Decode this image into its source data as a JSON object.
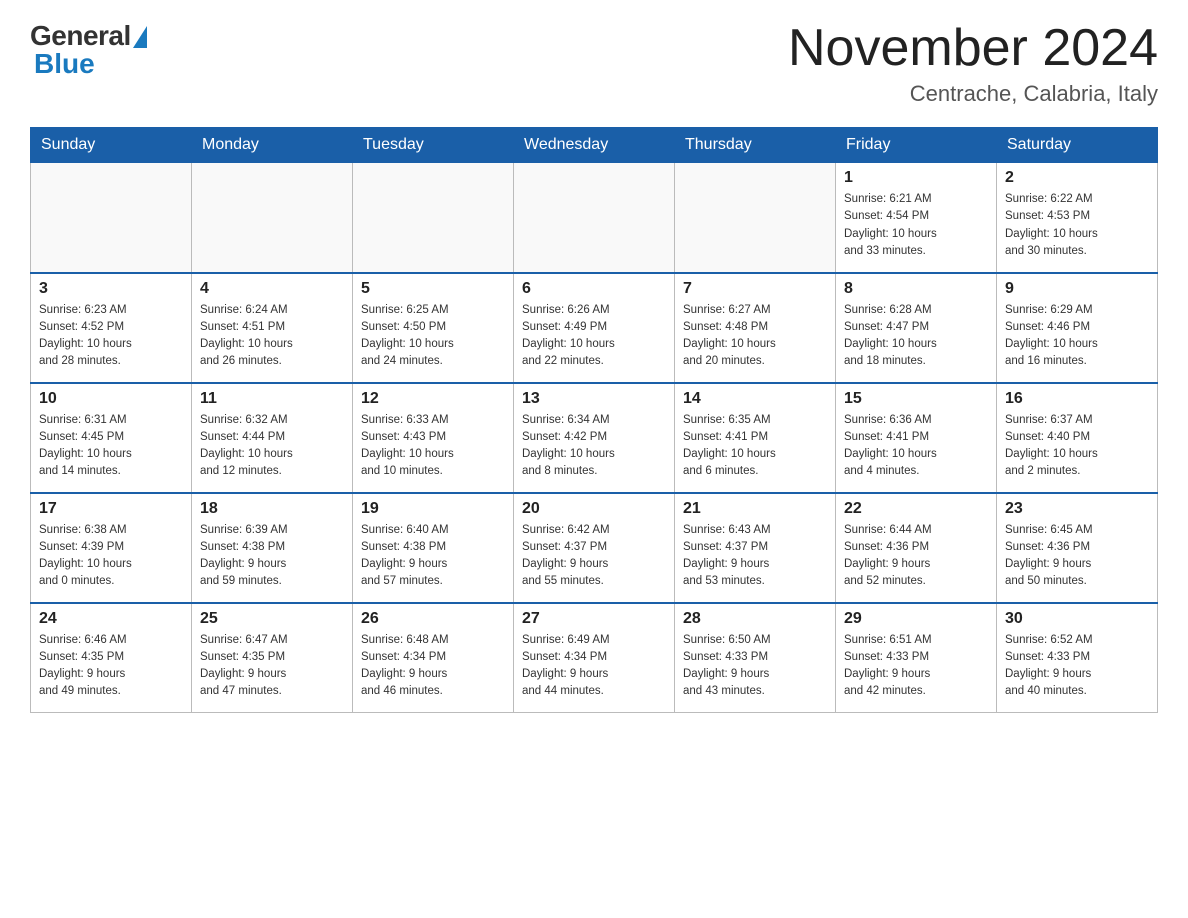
{
  "header": {
    "logo": {
      "general_text": "General",
      "blue_text": "Blue"
    },
    "title": "November 2024",
    "location": "Centrache, Calabria, Italy"
  },
  "days_of_week": [
    "Sunday",
    "Monday",
    "Tuesday",
    "Wednesday",
    "Thursday",
    "Friday",
    "Saturday"
  ],
  "weeks": [
    {
      "days": [
        {
          "number": "",
          "info": ""
        },
        {
          "number": "",
          "info": ""
        },
        {
          "number": "",
          "info": ""
        },
        {
          "number": "",
          "info": ""
        },
        {
          "number": "",
          "info": ""
        },
        {
          "number": "1",
          "info": "Sunrise: 6:21 AM\nSunset: 4:54 PM\nDaylight: 10 hours\nand 33 minutes."
        },
        {
          "number": "2",
          "info": "Sunrise: 6:22 AM\nSunset: 4:53 PM\nDaylight: 10 hours\nand 30 minutes."
        }
      ]
    },
    {
      "days": [
        {
          "number": "3",
          "info": "Sunrise: 6:23 AM\nSunset: 4:52 PM\nDaylight: 10 hours\nand 28 minutes."
        },
        {
          "number": "4",
          "info": "Sunrise: 6:24 AM\nSunset: 4:51 PM\nDaylight: 10 hours\nand 26 minutes."
        },
        {
          "number": "5",
          "info": "Sunrise: 6:25 AM\nSunset: 4:50 PM\nDaylight: 10 hours\nand 24 minutes."
        },
        {
          "number": "6",
          "info": "Sunrise: 6:26 AM\nSunset: 4:49 PM\nDaylight: 10 hours\nand 22 minutes."
        },
        {
          "number": "7",
          "info": "Sunrise: 6:27 AM\nSunset: 4:48 PM\nDaylight: 10 hours\nand 20 minutes."
        },
        {
          "number": "8",
          "info": "Sunrise: 6:28 AM\nSunset: 4:47 PM\nDaylight: 10 hours\nand 18 minutes."
        },
        {
          "number": "9",
          "info": "Sunrise: 6:29 AM\nSunset: 4:46 PM\nDaylight: 10 hours\nand 16 minutes."
        }
      ]
    },
    {
      "days": [
        {
          "number": "10",
          "info": "Sunrise: 6:31 AM\nSunset: 4:45 PM\nDaylight: 10 hours\nand 14 minutes."
        },
        {
          "number": "11",
          "info": "Sunrise: 6:32 AM\nSunset: 4:44 PM\nDaylight: 10 hours\nand 12 minutes."
        },
        {
          "number": "12",
          "info": "Sunrise: 6:33 AM\nSunset: 4:43 PM\nDaylight: 10 hours\nand 10 minutes."
        },
        {
          "number": "13",
          "info": "Sunrise: 6:34 AM\nSunset: 4:42 PM\nDaylight: 10 hours\nand 8 minutes."
        },
        {
          "number": "14",
          "info": "Sunrise: 6:35 AM\nSunset: 4:41 PM\nDaylight: 10 hours\nand 6 minutes."
        },
        {
          "number": "15",
          "info": "Sunrise: 6:36 AM\nSunset: 4:41 PM\nDaylight: 10 hours\nand 4 minutes."
        },
        {
          "number": "16",
          "info": "Sunrise: 6:37 AM\nSunset: 4:40 PM\nDaylight: 10 hours\nand 2 minutes."
        }
      ]
    },
    {
      "days": [
        {
          "number": "17",
          "info": "Sunrise: 6:38 AM\nSunset: 4:39 PM\nDaylight: 10 hours\nand 0 minutes."
        },
        {
          "number": "18",
          "info": "Sunrise: 6:39 AM\nSunset: 4:38 PM\nDaylight: 9 hours\nand 59 minutes."
        },
        {
          "number": "19",
          "info": "Sunrise: 6:40 AM\nSunset: 4:38 PM\nDaylight: 9 hours\nand 57 minutes."
        },
        {
          "number": "20",
          "info": "Sunrise: 6:42 AM\nSunset: 4:37 PM\nDaylight: 9 hours\nand 55 minutes."
        },
        {
          "number": "21",
          "info": "Sunrise: 6:43 AM\nSunset: 4:37 PM\nDaylight: 9 hours\nand 53 minutes."
        },
        {
          "number": "22",
          "info": "Sunrise: 6:44 AM\nSunset: 4:36 PM\nDaylight: 9 hours\nand 52 minutes."
        },
        {
          "number": "23",
          "info": "Sunrise: 6:45 AM\nSunset: 4:36 PM\nDaylight: 9 hours\nand 50 minutes."
        }
      ]
    },
    {
      "days": [
        {
          "number": "24",
          "info": "Sunrise: 6:46 AM\nSunset: 4:35 PM\nDaylight: 9 hours\nand 49 minutes."
        },
        {
          "number": "25",
          "info": "Sunrise: 6:47 AM\nSunset: 4:35 PM\nDaylight: 9 hours\nand 47 minutes."
        },
        {
          "number": "26",
          "info": "Sunrise: 6:48 AM\nSunset: 4:34 PM\nDaylight: 9 hours\nand 46 minutes."
        },
        {
          "number": "27",
          "info": "Sunrise: 6:49 AM\nSunset: 4:34 PM\nDaylight: 9 hours\nand 44 minutes."
        },
        {
          "number": "28",
          "info": "Sunrise: 6:50 AM\nSunset: 4:33 PM\nDaylight: 9 hours\nand 43 minutes."
        },
        {
          "number": "29",
          "info": "Sunrise: 6:51 AM\nSunset: 4:33 PM\nDaylight: 9 hours\nand 42 minutes."
        },
        {
          "number": "30",
          "info": "Sunrise: 6:52 AM\nSunset: 4:33 PM\nDaylight: 9 hours\nand 40 minutes."
        }
      ]
    }
  ]
}
